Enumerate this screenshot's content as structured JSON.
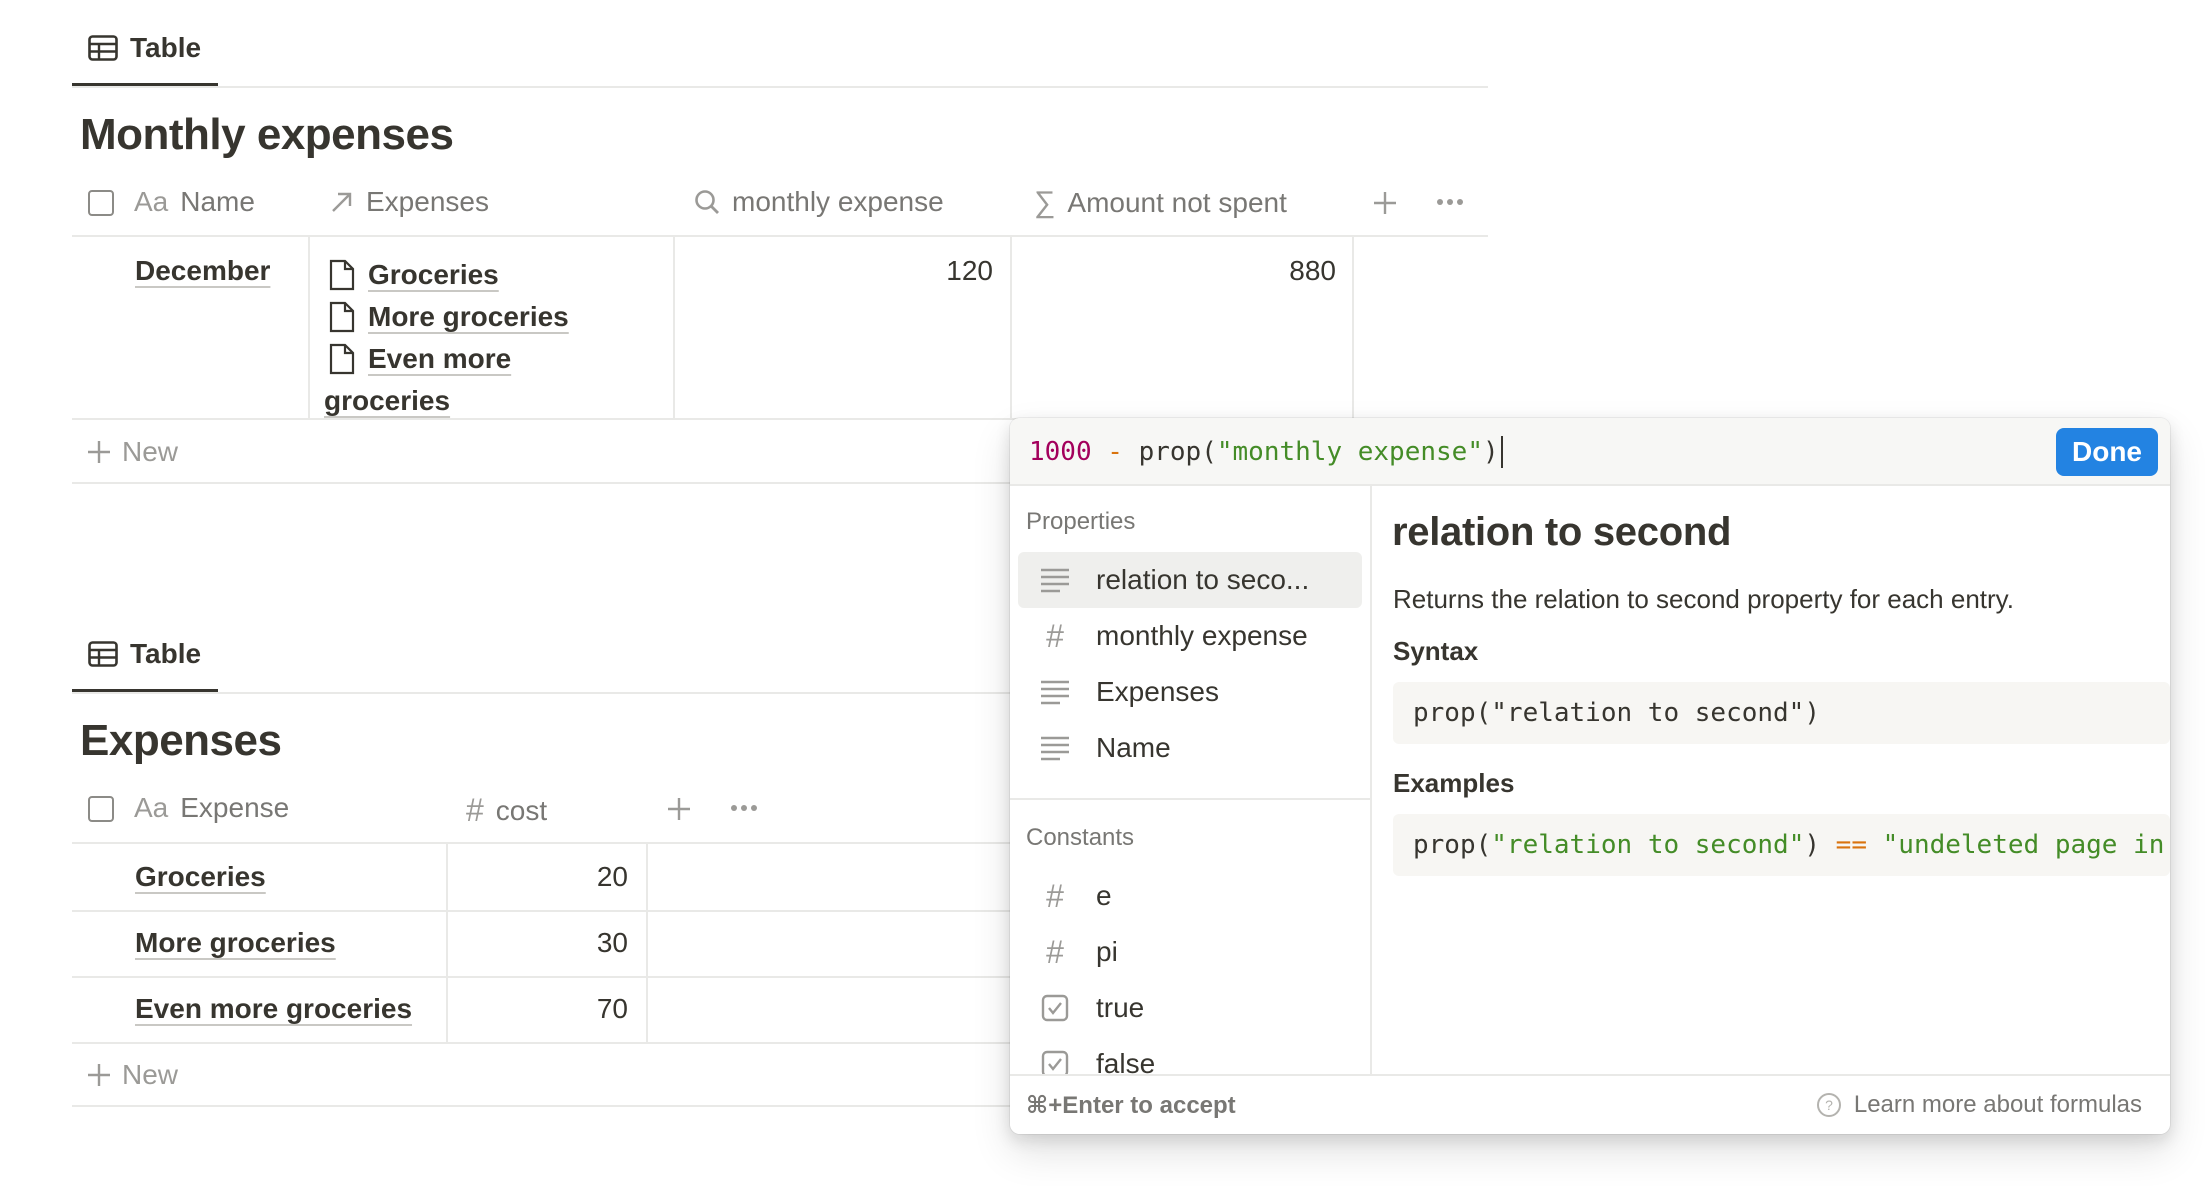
{
  "table1": {
    "tab_label": "Table",
    "title": "Monthly expenses",
    "columns": {
      "name": "Name",
      "expenses": "Expenses",
      "monthly_expense": "monthly expense",
      "amount_not_spent": "Amount not spent"
    },
    "row": {
      "name": "December",
      "expenses": [
        "Groceries",
        "More groceries",
        "Even more",
        "groceries"
      ],
      "monthly_expense": "120",
      "amount_not_spent": "880"
    },
    "new_label": "New",
    "name_prefix": "Aa"
  },
  "table2": {
    "tab_label": "Table",
    "title": "Expenses",
    "columns": {
      "expense": "Expense",
      "cost": "cost"
    },
    "name_prefix": "Aa",
    "rows": [
      {
        "expense": "Groceries",
        "cost": "20"
      },
      {
        "expense": "More groceries",
        "cost": "30"
      },
      {
        "expense": "Even more groceries",
        "cost": "70"
      }
    ],
    "new_label": "New"
  },
  "formula": {
    "num": "1000",
    "op": "-",
    "fn": "prop(",
    "str": "\"monthly expense\"",
    "close": ")",
    "done_label": "Done",
    "properties_label": "Properties",
    "properties": [
      "relation to seco...",
      "monthly expense",
      "Expenses",
      "Name"
    ],
    "constants_label": "Constants",
    "constants": [
      "e",
      "pi",
      "true",
      "false"
    ],
    "detail": {
      "title": "relation to second",
      "description": "Returns the relation to second property for each entry.",
      "syntax_label": "Syntax",
      "syntax_code": "prop(\"relation to second\")",
      "examples_label": "Examples",
      "example_fn": "prop(",
      "example_str": "\"relation to second\"",
      "example_close": ")",
      "example_op": "==",
      "example_str2": "\"undeleted page in"
    },
    "footer_hint": "⌘+Enter to accept",
    "footer_link": "Learn more about formulas"
  },
  "colors": {
    "accent": "#2383e2",
    "code_number": "#a3005c",
    "code_string": "#448c27",
    "text": "#37352f",
    "muted": "#787774"
  }
}
